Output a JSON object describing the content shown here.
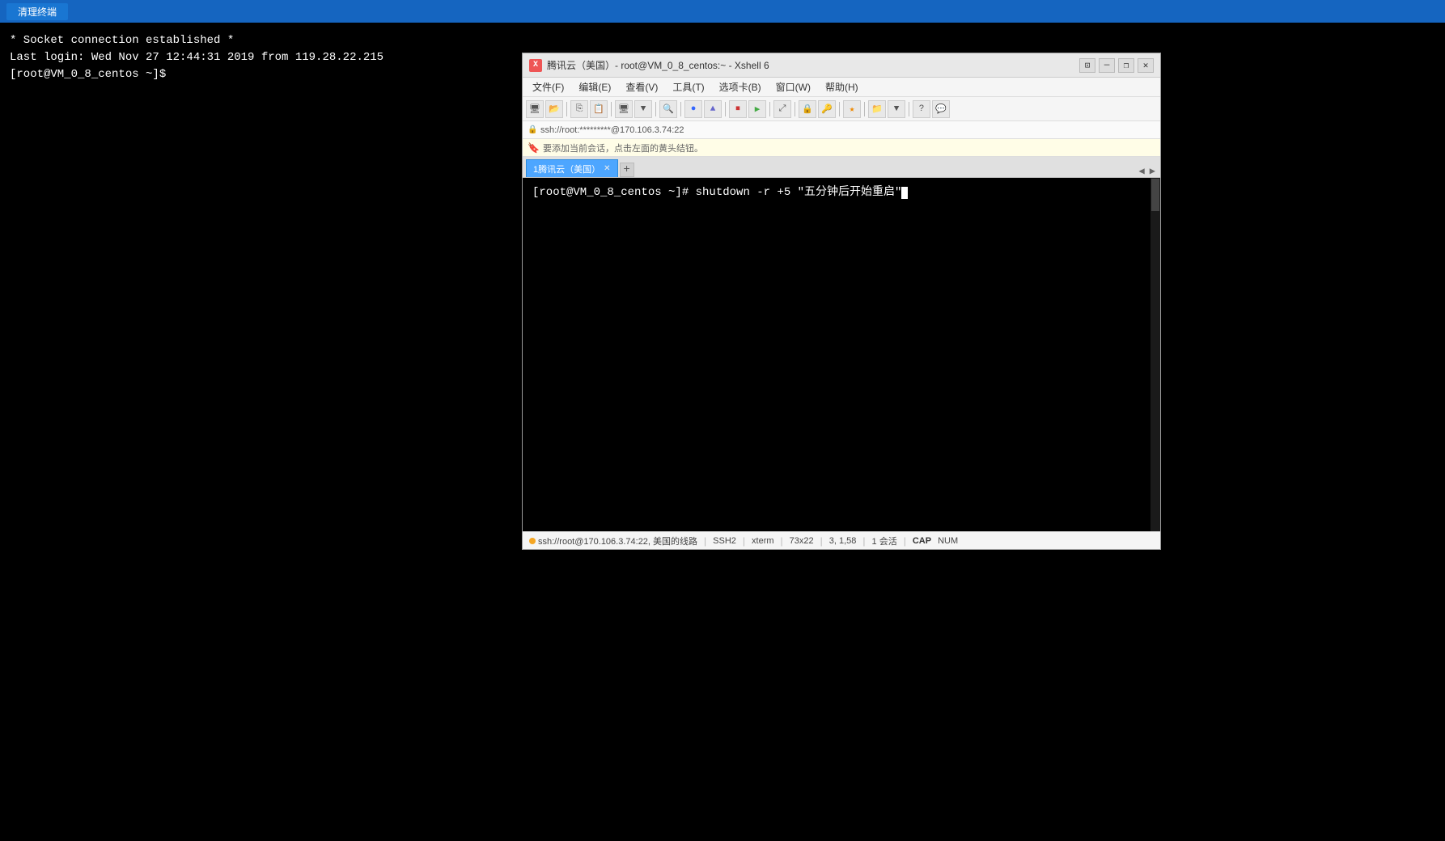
{
  "topBar": {
    "btnLabel": "清理终端"
  },
  "bgTerminal": {
    "line1": "* Socket connection established *",
    "line2": "Last login: Wed Nov 27 12:44:31 2019 from 119.28.22.215",
    "line3": "[root@VM_0_8_centos ~]$ "
  },
  "xshell": {
    "titleBar": {
      "icon": "X",
      "title": "腾讯云（美国）- root@VM_0_8_centos:~ - Xshell 6",
      "controls": {
        "minimize": "—",
        "restore": "❐",
        "close": "✕"
      }
    },
    "menuBar": {
      "items": [
        "文件(F)",
        "编辑(E)",
        "查看(V)",
        "工具(T)",
        "选项卡(B)",
        "窗口(W)",
        "帮助(H)"
      ]
    },
    "addressBar": {
      "text": "ssh://root:*********@170.106.3.74:22"
    },
    "tipBar": {
      "text": "要添加当前会话，点击左面的黄头结钮。"
    },
    "tabBar": {
      "tab1": "1腾讯云（美国）",
      "addBtn": "+",
      "navLeft": "◀",
      "navRight": "▶"
    },
    "terminal": {
      "command": "[root@VM_0_8_centos ~]# shutdown -r +5 \"五分钟后开始重启\""
    },
    "statusBar": {
      "connection": "ssh://root@170.106.3.74:22, 美国的线路",
      "protocol": "SSH2",
      "term": "xterm",
      "size": "73x22",
      "pos": "3, 1,58",
      "sessions": "1 会活",
      "cap": "CAP",
      "num": "NUM"
    }
  }
}
